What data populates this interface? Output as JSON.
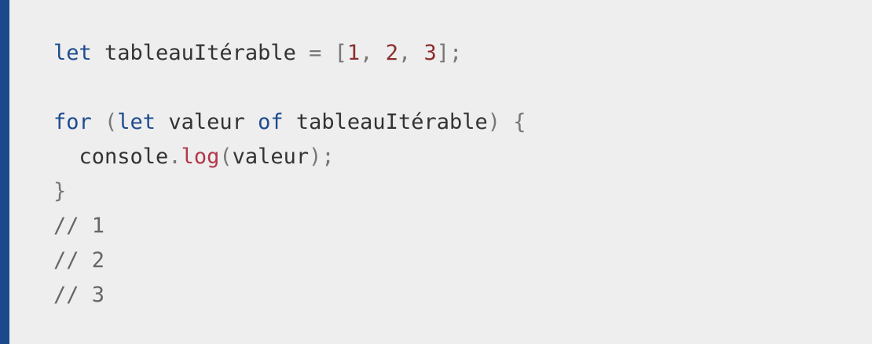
{
  "colors": {
    "accent_bar": "#1b4a8c",
    "background": "#eeeeee",
    "keyword": "#1f4b8f",
    "number": "#8b2e2e",
    "function": "#b0384a",
    "punctuation": "#777777",
    "comment": "#666666",
    "text": "#333333"
  },
  "code": {
    "line1": {
      "kw_let": "let",
      "var": " tableauItérable ",
      "eq": "=",
      "space": " ",
      "open": "[",
      "n1": "1",
      "c1": ", ",
      "n2": "2",
      "c2": ", ",
      "n3": "3",
      "close": "];"
    },
    "line3": {
      "kw_for": "for",
      "paren_open": " (",
      "kw_let": "let",
      "valeur": " valeur ",
      "kw_of": "of",
      "iter": " tableauItérable",
      "paren_close": ")",
      "brace": " {"
    },
    "line4": {
      "indent_obj": "  console",
      "dot": ".",
      "method": "log",
      "p_open": "(",
      "arg": "valeur",
      "p_close": ");"
    },
    "line5": {
      "brace_close": "}"
    },
    "comments": [
      "// 1",
      "// 2",
      "// 3"
    ]
  }
}
